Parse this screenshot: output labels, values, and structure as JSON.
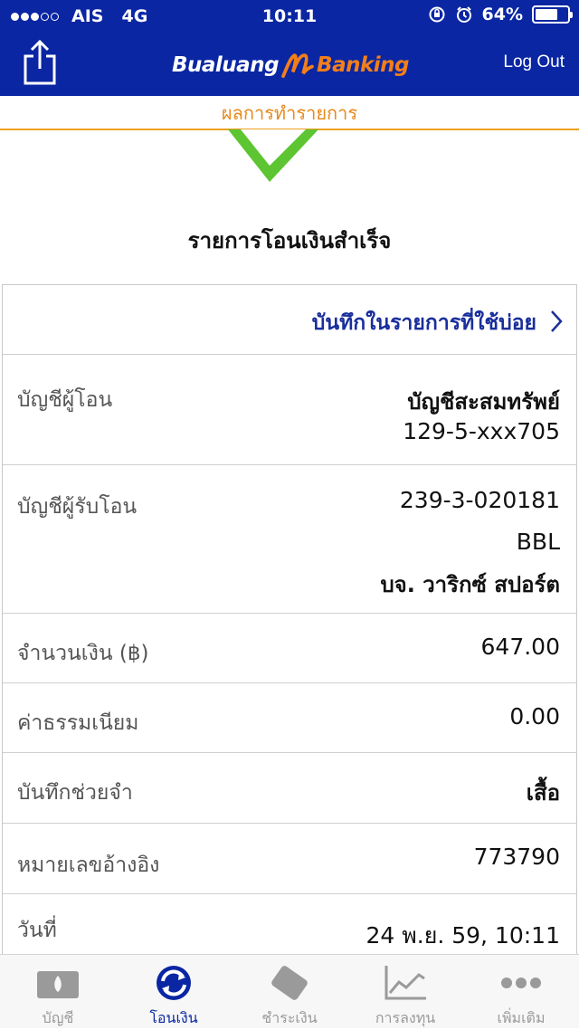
{
  "status_bar": {
    "carrier": "AIS",
    "network": "4G",
    "time": "10:11",
    "battery": "64%",
    "signal_strength": 3
  },
  "header": {
    "logo_word_1": "Bualuang",
    "logo_word_2": "Banking",
    "logout_label": "Log Out"
  },
  "subheader": {
    "title": "ผลการทำรายการ"
  },
  "success": {
    "title": "รายการโอนเงินสำเร็จ"
  },
  "favorite": {
    "label": "บันทึกในรายการที่ใช้บ่อย"
  },
  "details": {
    "from_account": {
      "label": "บัญชีผู้โอน",
      "name": "บัญชีสะสมทรัพย์",
      "number": "129-5-xxx705"
    },
    "to_account": {
      "label": "บัญชีผู้รับโอน",
      "number": "239-3-020181",
      "bank": "BBL",
      "name": "บจ. วาริกซ์ สปอร์ต"
    },
    "amount": {
      "label": "จำนวนเงิน (฿)",
      "value": "647.00"
    },
    "fee": {
      "label": "ค่าธรรมเนียม",
      "value": "0.00"
    },
    "memo": {
      "label": "บันทึกช่วยจำ",
      "value": "เสื้อ"
    },
    "reference": {
      "label": "หมายเลขอ้างอิง",
      "value": "773790"
    },
    "date": {
      "label": "วันที่",
      "value": "24 พ.ย. 59, 10:11"
    }
  },
  "tabs": [
    {
      "label": "บัญชี",
      "icon": "wallet-icon",
      "active": false
    },
    {
      "label": "โอนเงิน",
      "icon": "transfer-icon",
      "active": true
    },
    {
      "label": "ชำระเงิน",
      "icon": "payment-icon",
      "active": false
    },
    {
      "label": "การลงทุน",
      "icon": "chart-icon",
      "active": false
    },
    {
      "label": "เพิ่มเติม",
      "icon": "more-icon",
      "active": false
    }
  ],
  "colors": {
    "header_bg": "#0a26a3",
    "accent_orange": "#f37f1a",
    "success_green": "#5cc531",
    "link_blue": "#1a2f9c"
  }
}
